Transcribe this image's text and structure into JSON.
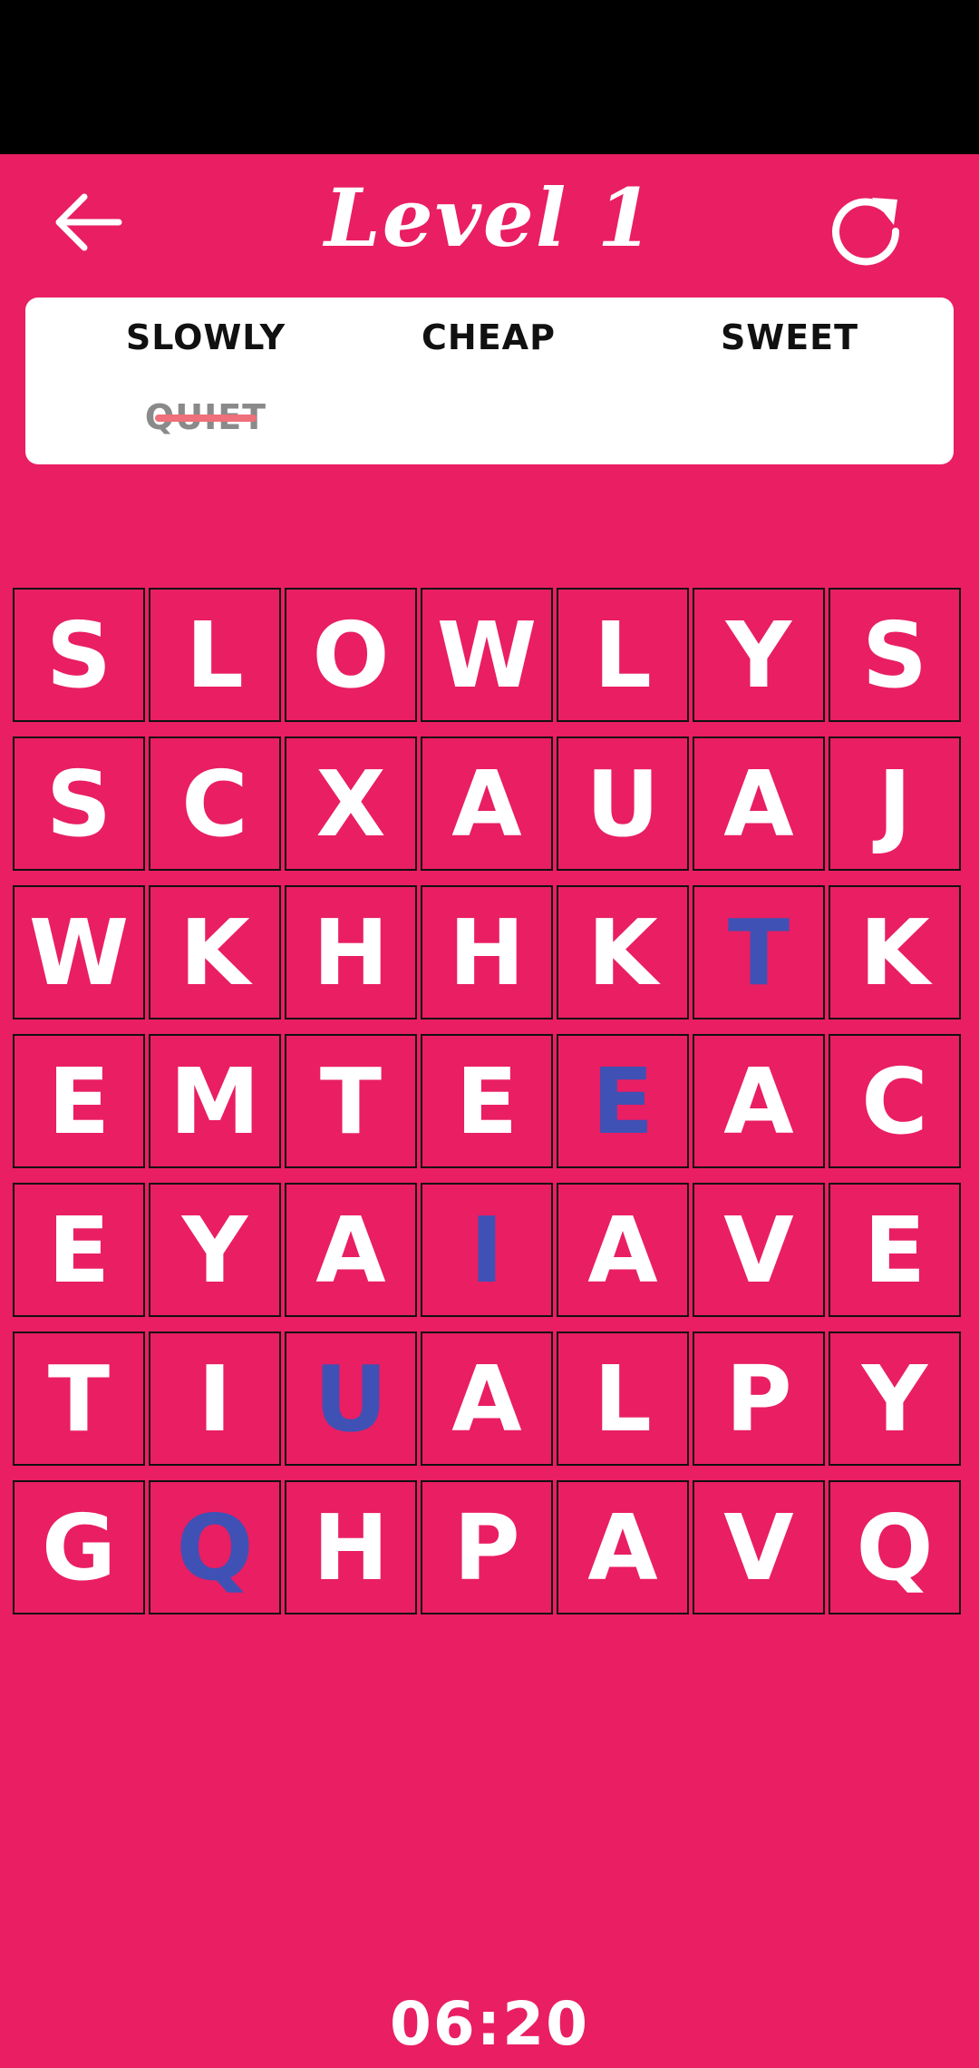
{
  "header": {
    "title": "Level 1",
    "back_icon": "arrow-left-icon",
    "refresh_icon": "refresh-icon"
  },
  "words": [
    {
      "text": "SLOWLY",
      "found": false
    },
    {
      "text": "CHEAP",
      "found": false
    },
    {
      "text": "SWEET",
      "found": false
    },
    {
      "text": "QUIET",
      "found": true
    }
  ],
  "grid": [
    [
      "S",
      "L",
      "O",
      "W",
      "L",
      "Y",
      "S"
    ],
    [
      "S",
      "C",
      "X",
      "A",
      "U",
      "A",
      "J"
    ],
    [
      "W",
      "K",
      "H",
      "H",
      "K",
      "T",
      "K"
    ],
    [
      "E",
      "M",
      "T",
      "E",
      "E",
      "A",
      "C"
    ],
    [
      "E",
      "Y",
      "A",
      "I",
      "A",
      "V",
      "E"
    ],
    [
      "T",
      "I",
      "U",
      "A",
      "L",
      "P",
      "Y"
    ],
    [
      "G",
      "Q",
      "H",
      "P",
      "A",
      "V",
      "Q"
    ]
  ],
  "highlighted": [
    [
      2,
      5
    ],
    [
      3,
      4
    ],
    [
      4,
      3
    ],
    [
      5,
      2
    ],
    [
      6,
      1
    ]
  ],
  "timer": "06:20",
  "colors": {
    "background": "#E91E63",
    "highlight": "#3F51B5",
    "status_bar": "#000000",
    "strike": "#EF6F7A"
  }
}
